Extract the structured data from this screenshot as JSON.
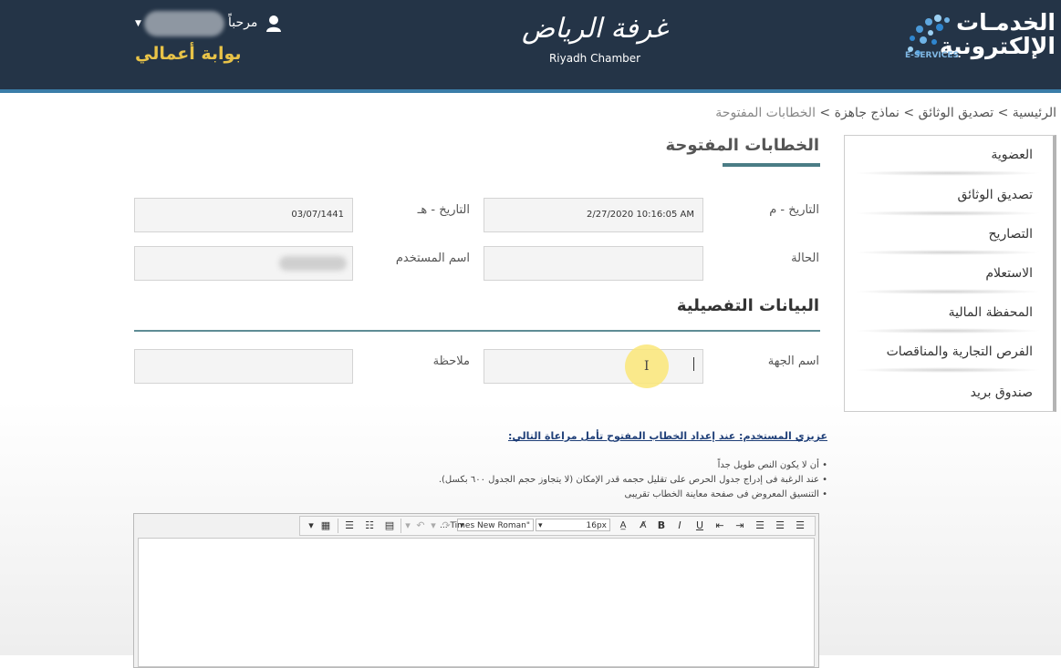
{
  "header": {
    "eservices_title_line1": "الخدمـات",
    "eservices_title_line2": "الإلكترونية",
    "eservices_sub": "E-SERVICES",
    "chamber_ar": "غرفة الرياض",
    "chamber_en": "Riyadh Chamber",
    "welcome": "مرحباً",
    "portal": "بوابة أعمالي"
  },
  "breadcrumb": {
    "home": "الرئيسية",
    "sep1": " > ",
    "docs": "تصديق الوثائق",
    "sep2": " > ",
    "templates": "نماذج جاهزة",
    "sep3": " > ",
    "current": "الخطابات المفتوحة"
  },
  "sidebar": {
    "items": [
      {
        "label": "العضوية"
      },
      {
        "label": "تصديق الوثائق"
      },
      {
        "label": "التصاريح"
      },
      {
        "label": "الاستعلام"
      },
      {
        "label": "المحفظة المالية"
      },
      {
        "label": "الفرص التجارية والمناقصات"
      },
      {
        "label": "صندوق بريد"
      }
    ]
  },
  "form": {
    "title": "الخطابات المفتوحة",
    "date_g_label": "التاريخ - م",
    "date_g_value": "2/27/2020 10:16:05 AM",
    "date_h_label": "التاريخ - هـ",
    "date_h_value": "03/07/1441",
    "status_label": "الحالة",
    "status_value": "",
    "username_label": "اسم المستخدم",
    "details_title": "البيانات التفصيلية",
    "entity_label": "اسم الجهة",
    "entity_value": "",
    "note_label": "ملاحظة",
    "note_value": ""
  },
  "notes": {
    "title": "عزيزي المستخدم: عند إعداد الخطاب المفتوح تأمل مراعاة التالي:",
    "items": [
      "• أن لا يكون النص طويل جداً",
      "• عند الرغبة فى إدراج جدول الحرص على تقليل حجمه قدر الإمكان (لا يتجاوز حجم الجدول ٦٠٠ بكسل).",
      "• التنسيق المعروض فى صفحة معاينة الخطاب تقريبى"
    ]
  },
  "editor": {
    "font_name": "\"Times New Roman ...",
    "font_size": "16px",
    "bold": "B",
    "italic": "I",
    "underline": "U"
  },
  "colors": {
    "header_bg": "#243447",
    "accent_line": "#3b7da8",
    "portal_gold": "#e8c348",
    "note_title": "#1f3f78"
  }
}
